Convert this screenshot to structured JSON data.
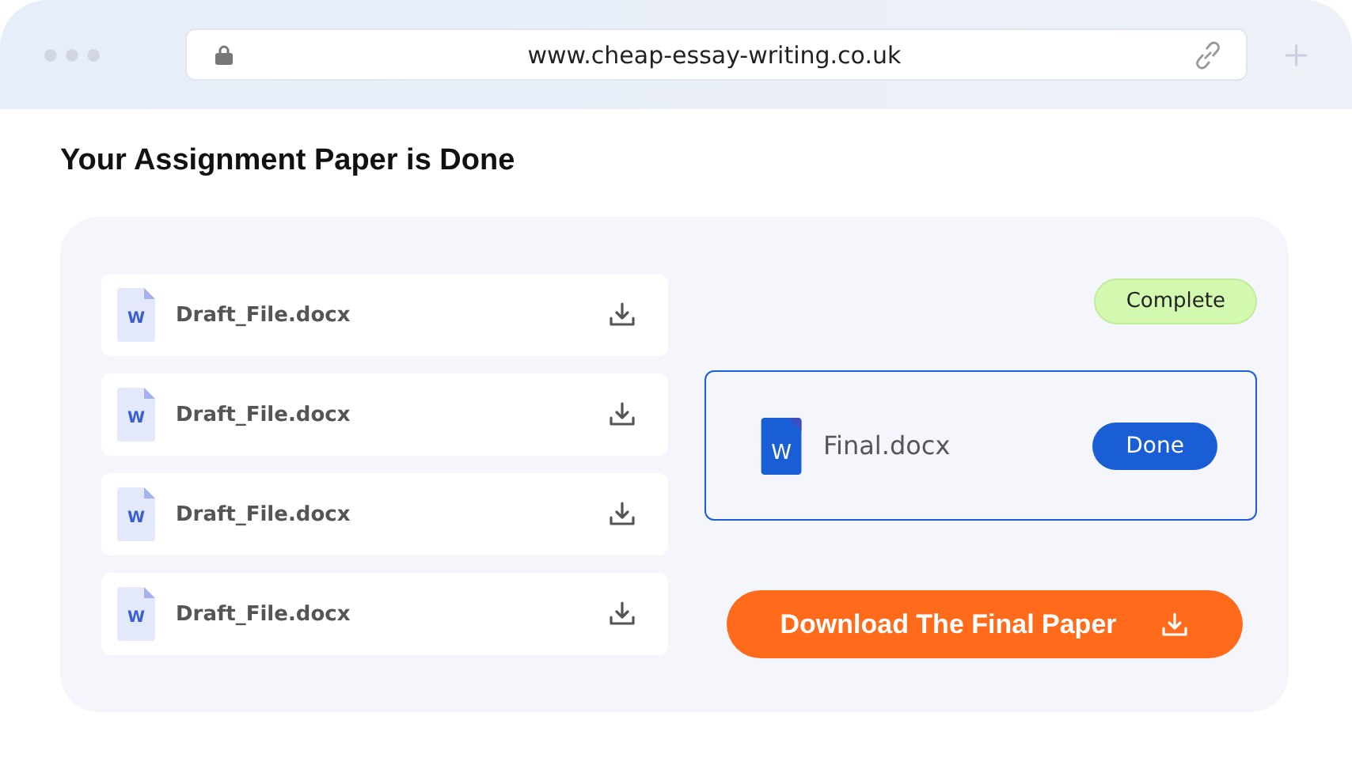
{
  "browser": {
    "url": "www.cheap-essay-writing.co.uk"
  },
  "heading": "Your Assignment Paper is Done",
  "drafts": [
    {
      "icon_label": "W",
      "name": "Draft_File.docx"
    },
    {
      "icon_label": "W",
      "name": "Draft_File.docx"
    },
    {
      "icon_label": "W",
      "name": "Draft_File.docx"
    },
    {
      "icon_label": "W",
      "name": "Draft_File.docx"
    }
  ],
  "status_badge": "Complete",
  "final_file": {
    "icon_label": "W",
    "name": "Final.docx",
    "button": "Done"
  },
  "download_button": "Download The Final Paper"
}
